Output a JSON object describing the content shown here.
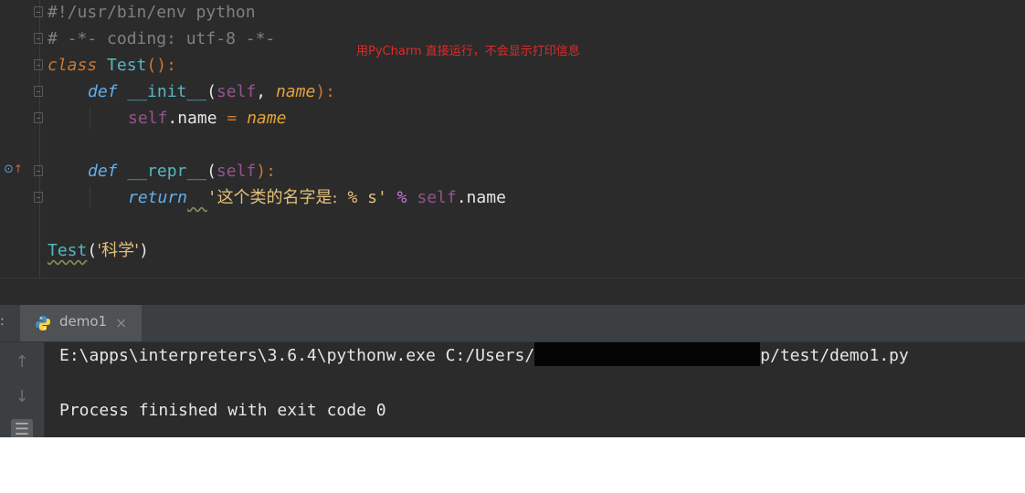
{
  "editor": {
    "lines": {
      "l1": "#!/usr/bin/env python",
      "l2": "# -*- coding: utf-8 -*-",
      "l3_kw": "class",
      "l3_name": "Test",
      "l3_punct": "():",
      "l4_kw": "def",
      "l4_name": "__init__",
      "l4_p1": "(",
      "l4_self": "self",
      "l4_comma": ", ",
      "l4_param": "name",
      "l4_p2": "):",
      "l5_self": "self",
      "l5_attr": ".name ",
      "l5_eq": "=",
      "l5_val": "name",
      "l7_kw": "def",
      "l7_name": "__repr__",
      "l7_p1": "(",
      "l7_self": "self",
      "l7_p2": "):",
      "l8_kw": "return",
      "l8_str_open": "'",
      "l8_str_cjk": "这个类的名字是:",
      "l8_str_rest": " % s'",
      "l8_op": "%",
      "l8_self": "self",
      "l8_attr": ".name",
      "l10_call": "Test",
      "l10_open": "(",
      "l10_str": "'科学'",
      "l10_close": ")"
    },
    "annotation": "用PyCharm 直接运行，不会显示打印信息"
  },
  "run_panel": {
    "colon": ":",
    "tab_label": "demo1",
    "tab_close": "×",
    "console_line1_a": "E:\\apps\\interpreters\\3.6.4\\pythonw.exe C:/Users/",
    "console_line1_b": "p/test/demo1.py",
    "console_line2": "Process finished with exit code 0"
  },
  "icons": {
    "run_gutter": "override-method-icon",
    "tab": "python-icon",
    "scroll_up": "arrow-up-icon",
    "scroll_down": "arrow-down-icon",
    "soft_wrap": "soft-wrap-icon"
  },
  "colors": {
    "annotation": "#e02a2a",
    "editor_bg": "#2b2b2b"
  }
}
